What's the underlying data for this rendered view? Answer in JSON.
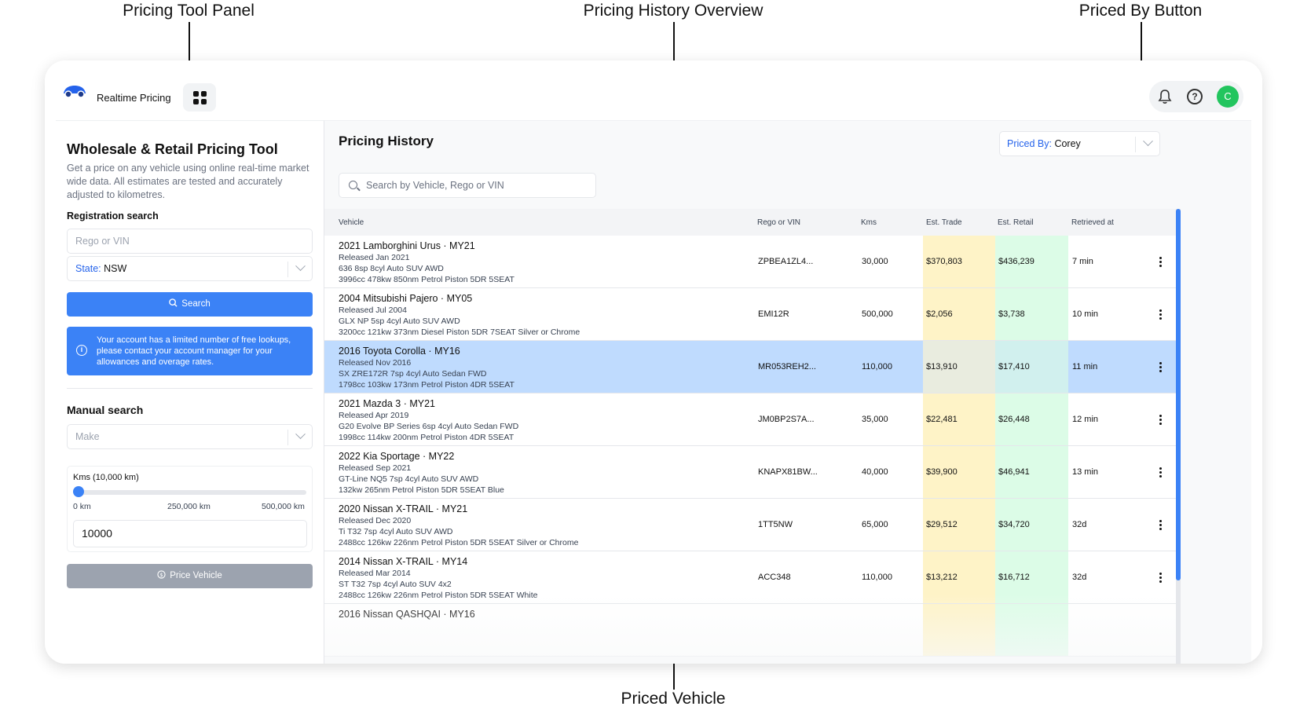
{
  "callouts": {
    "pricing_tool_panel": "Pricing Tool Panel",
    "pricing_history_overview": "Pricing History Overview",
    "priced_by_button": "Priced By Button",
    "priced_vehicle": "Priced Vehicle"
  },
  "header": {
    "app_title": "Realtime Pricing",
    "avatar_initial": "C",
    "help_glyph": "?",
    "icons": [
      "car-logo-icon",
      "grid-icon",
      "bell-icon",
      "help-icon"
    ]
  },
  "pricing_tool": {
    "title": "Wholesale & Retail Pricing Tool",
    "description": "Get a price on any vehicle using online real-time market wide data. All estimates are tested and accurately adjusted to kilometres.",
    "registration_label": "Registration search",
    "rego_placeholder": "Rego or VIN",
    "state_label": "State:",
    "state_value": "NSW",
    "search_label": "Search",
    "info_glyph": "i",
    "info_text": "Your account has a limited number of free lookups, please contact your account manager for your allowances and overage rates.",
    "manual_label": "Manual search",
    "make_placeholder": "Make",
    "kms_label": "Kms (10,000 km)",
    "kms_slider_fraction": 0.02,
    "ticks": [
      "0 km",
      "250,000 km",
      "500,000 km"
    ],
    "kms_value": "10000",
    "price_label": "Price Vehicle",
    "accent_color": "#3b82f6"
  },
  "history": {
    "title": "Pricing History",
    "priced_by_label": "Priced By:",
    "priced_by_value": "Corey",
    "search_placeholder": "Search by Vehicle, Rego or VIN",
    "columns": [
      "Vehicle",
      "Rego or VIN",
      "Kms",
      "Est. Trade",
      "Est. Retail",
      "Retrieved at"
    ],
    "rows": [
      {
        "title": "2021 Lamborghini Urus · MY21",
        "released": "Released Jan 2021",
        "spec1": "636 8sp 8cyl Auto SUV AWD",
        "spec2": "3996cc 478kw 850nm Petrol Piston 5DR 5SEAT",
        "rego": "ZPBEA1ZL4...",
        "kms": "30,000",
        "trade": "$370,803",
        "retail": "$436,239",
        "time": "7 min"
      },
      {
        "title": "2004 Mitsubishi Pajero · MY05",
        "released": "Released Jul 2004",
        "spec1": "GLX NP 5sp 4cyl Auto SUV AWD",
        "spec2": "3200cc 121kw 373nm Diesel Piston 5DR 7SEAT Silver or Chrome",
        "rego": "EMI12R",
        "kms": "500,000",
        "trade": "$2,056",
        "retail": "$3,738",
        "time": "10 min"
      },
      {
        "title": "2016 Toyota Corolla · MY16",
        "released": "Released Nov 2016",
        "spec1": "SX ZRE172R 7sp 4cyl Auto Sedan FWD",
        "spec2": "1798cc 103kw 173nm Petrol Piston 4DR 5SEAT",
        "rego": "MR053REH2...",
        "kms": "110,000",
        "trade": "$13,910",
        "retail": "$17,410",
        "time": "11 min"
      },
      {
        "title": "2021 Mazda 3 · MY21",
        "released": "Released Apr 2019",
        "spec1": "G20 Evolve BP Series 6sp 4cyl Auto Sedan FWD",
        "spec2": "1998cc 114kw 200nm Petrol Piston 4DR 5SEAT",
        "rego": "JM0BP2S7A...",
        "kms": "35,000",
        "trade": "$22,481",
        "retail": "$26,448",
        "time": "12 min"
      },
      {
        "title": "2022 Kia Sportage · MY22",
        "released": "Released Sep 2021",
        "spec1": "GT-Line NQ5 7sp 4cyl Auto SUV AWD",
        "spec2": "132kw 265nm Petrol Piston 5DR 5SEAT Blue",
        "rego": "KNAPX81BW...",
        "kms": "40,000",
        "trade": "$39,900",
        "retail": "$46,941",
        "time": "13 min"
      },
      {
        "title": "2020 Nissan X-TRAIL · MY21",
        "released": "Released Dec 2020",
        "spec1": "Ti T32 7sp 4cyl Auto SUV AWD",
        "spec2": "2488cc 126kw 226nm Petrol Piston 5DR 5SEAT Silver or Chrome",
        "rego": "1TT5NW",
        "kms": "65,000",
        "trade": "$29,512",
        "retail": "$34,720",
        "time": "32d"
      },
      {
        "title": "2014 Nissan X-TRAIL · MY14",
        "released": "Released Mar 2014",
        "spec1": "ST T32 7sp 4cyl Auto SUV 4x2",
        "spec2": "2488cc 126kw 226nm Petrol Piston 5DR 5SEAT White",
        "rego": "ACC348",
        "kms": "110,000",
        "trade": "$13,212",
        "retail": "$16,712",
        "time": "32d"
      },
      {
        "title": "2016 Nissan QASHQAI · MY16",
        "released": "",
        "spec1": "",
        "spec2": "",
        "rego": "",
        "kms": "",
        "trade": "",
        "retail": "",
        "time": ""
      }
    ],
    "selected_row_index": 2,
    "trade_color": "#fef3c7",
    "retail_color": "#dcfce7",
    "selected_color": "#bfdbfe"
  }
}
